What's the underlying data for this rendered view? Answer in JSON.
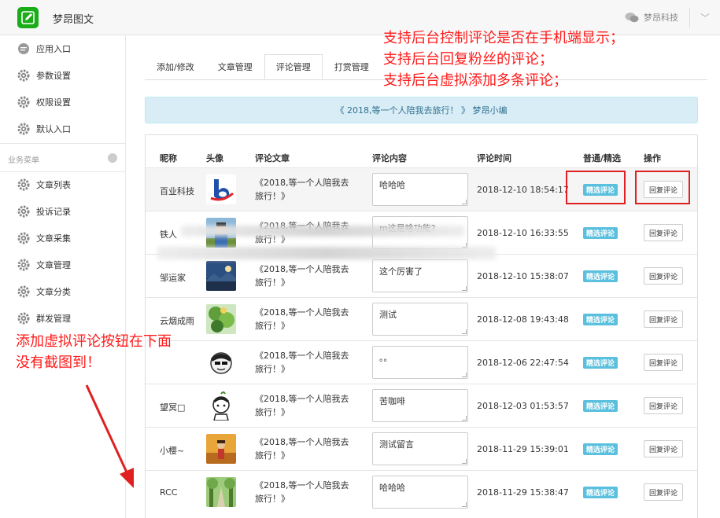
{
  "app": {
    "title": "梦昂图文",
    "company": "梦昂科技"
  },
  "colors": {
    "brand_green": "#1aad19",
    "info_blue": "#5bc0de",
    "annotation_red": "#ff1a1a",
    "banner_bg": "#d9edf7",
    "banner_text": "#31708f"
  },
  "sidebar": {
    "top_items": [
      {
        "label": "应用入口",
        "icon": "chat-bubble-icon"
      },
      {
        "label": "参数设置",
        "icon": "gear-icon"
      },
      {
        "label": "权限设置",
        "icon": "gear-icon"
      },
      {
        "label": "默认入口",
        "icon": "gear-icon"
      }
    ],
    "section_label": "业务菜单",
    "business_items": [
      {
        "label": "文章列表",
        "icon": "gear-icon"
      },
      {
        "label": "投诉记录",
        "icon": "gear-icon"
      },
      {
        "label": "文章采集",
        "icon": "gear-icon"
      },
      {
        "label": "文章管理",
        "icon": "gear-icon"
      },
      {
        "label": "文章分类",
        "icon": "gear-icon"
      },
      {
        "label": "群发管理",
        "icon": "gear-icon"
      }
    ]
  },
  "tabs": [
    {
      "label": "添加/修改"
    },
    {
      "label": "文章管理"
    },
    {
      "label": "评论管理",
      "active": true
    },
    {
      "label": "打赏管理"
    }
  ],
  "banner": {
    "text": "《 2018,等一个人陪我去旅行！ 》 梦昂小编"
  },
  "table": {
    "headers": {
      "nick": "昵称",
      "avatar": "头像",
      "article": "评论文章",
      "content": "评论内容",
      "time": "评论时间",
      "type": "普通/精选",
      "action": "操作"
    },
    "rows": [
      {
        "nick": "百业科技",
        "article": "《2018,等一个人陪我去旅行！》",
        "content": "哈哈哈",
        "time": "2018-12-10 18:54:17",
        "badge": "精选评论",
        "reply": "回复评论",
        "avatar_kind": "logo"
      },
      {
        "nick": "铁人",
        "article": "《2018,等一个人陪我去旅行！》",
        "content": "m这是啥功能?",
        "time": "2018-12-10 16:33:55",
        "badge": "精选评论",
        "reply": "回复评论",
        "avatar_kind": "person"
      },
      {
        "nick": "邹运家",
        "article": "《2018,等一个人陪我去旅行！》",
        "content": "这个厉害了",
        "time": "2018-12-10 15:38:07",
        "badge": "精选评论",
        "reply": "回复评论",
        "avatar_kind": "landscape"
      },
      {
        "nick": "云烟成雨",
        "article": "《2018,等一个人陪我去旅行！》",
        "content": "测试",
        "time": "2018-12-08 19:43:48",
        "badge": "精选评论",
        "reply": "回复评论",
        "avatar_kind": "leaves"
      },
      {
        "nick": "",
        "article": "《2018,等一个人陪我去旅行！》",
        "content": "。。",
        "time": "2018-12-06 22:47:54",
        "badge": "精选评论",
        "reply": "回复评论",
        "avatar_kind": "cartoon"
      },
      {
        "nick": "望冥□",
        "article": "《2018,等一个人陪我去旅行！》",
        "content": "苦咖啡",
        "time": "2018-12-03 01:53:57",
        "badge": "精选评论",
        "reply": "回复评论",
        "avatar_kind": "sketch"
      },
      {
        "nick": "小樱~",
        "article": "《2018,等一个人陪我去旅行！》",
        "content": "测试留言",
        "time": "2018-11-29 15:39:01",
        "badge": "精选评论",
        "reply": "回复评论",
        "avatar_kind": "autumn"
      },
      {
        "nick": "RCC",
        "article": "《2018,等一个人陪我去旅行！》",
        "content": "哈哈哈",
        "time": "2018-11-29 15:38:47",
        "badge": "精选评论",
        "reply": "回复评论",
        "avatar_kind": "trees"
      }
    ]
  },
  "annotations": {
    "top": [
      "支持后台控制评论是否在手机端显示；",
      "支持后台回复粉丝的评论；",
      "支持后台虚拟添加多条评论；"
    ],
    "bottom": [
      "添加虚拟评论按钮在下面",
      "没有截图到！"
    ]
  }
}
